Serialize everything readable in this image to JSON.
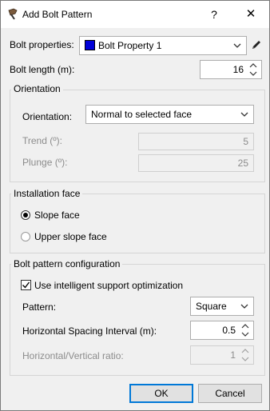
{
  "window": {
    "title": "Add Bolt Pattern",
    "help_glyph": "?",
    "close_glyph": "✕"
  },
  "bolt": {
    "properties_label": "Bolt properties:",
    "properties_value": "Bolt Property 1",
    "properties_color": "#0000d8",
    "length_label": "Bolt length (m):",
    "length_value": "16"
  },
  "orientation": {
    "group_title": "Orientation",
    "label": "Orientation:",
    "value": "Normal to selected face",
    "trend_label": "Trend (º):",
    "trend_value": "5",
    "plunge_label": "Plunge (º):",
    "plunge_value": "25"
  },
  "installation": {
    "group_title": "Installation face",
    "options": [
      {
        "label": "Slope face",
        "selected": true
      },
      {
        "label": "Upper slope face",
        "selected": false
      }
    ]
  },
  "pattern_config": {
    "group_title": "Bolt pattern configuration",
    "optimization_label": "Use intelligent support optimization",
    "optimization_checked": true,
    "pattern_label": "Pattern:",
    "pattern_value": "Square",
    "spacing_label": "Horizontal Spacing Interval (m):",
    "spacing_value": "0.5",
    "ratio_label": "Horizontal/Vertical ratio:",
    "ratio_value": "1"
  },
  "buttons": {
    "ok": "OK",
    "cancel": "Cancel"
  },
  "icons": {
    "app": "bolt-pattern-icon",
    "edit": "pencil-icon",
    "dropdown": "chevron-down-icon",
    "spin_up": "chevron-up-icon",
    "spin_down": "chevron-down-icon"
  }
}
